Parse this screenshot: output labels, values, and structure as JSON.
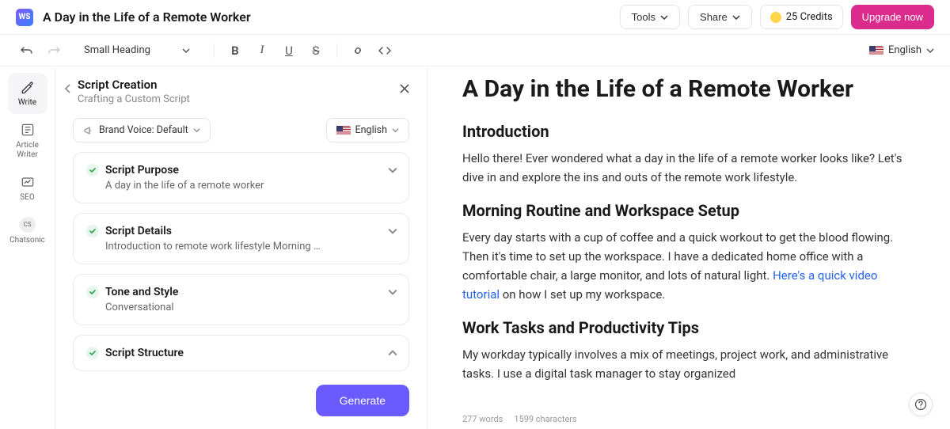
{
  "header": {
    "logo_text": "WS",
    "doc_title": "A Day in the Life of a Remote Worker",
    "tools_label": "Tools",
    "share_label": "Share",
    "credits_text": "25 Credits",
    "upgrade_label": "Upgrade now"
  },
  "toolbar": {
    "heading_label": "Small Heading",
    "lang_label": "English"
  },
  "rail": {
    "write": "Write",
    "article": "Article Writer",
    "seo": "SEO",
    "chatsonic": "Chatsonic"
  },
  "panel": {
    "title": "Script Creation",
    "subtitle": "Crafting a Custom Script",
    "brand_voice": "Brand Voice: Default",
    "lang": "English",
    "cards": [
      {
        "title": "Script Purpose",
        "sub": "A day in the life of a remote worker",
        "open": false
      },
      {
        "title": "Script Details",
        "sub": "Introduction to remote work lifestyle Morning …",
        "open": false
      },
      {
        "title": "Tone and Style",
        "sub": "Conversational",
        "open": false
      },
      {
        "title": "Script Structure",
        "sub": "",
        "open": true
      }
    ],
    "generate": "Generate"
  },
  "doc": {
    "h1": "A Day in the Life of a Remote Worker",
    "intro_h": "Introduction",
    "intro_p": "Hello there! Ever wondered what a day in the life of a remote worker looks like? Let's dive in and explore the ins and outs of the remote work lifestyle.",
    "morning_h": "Morning Routine and Workspace Setup",
    "morning_p1": "Every day starts with a cup of coffee and a quick workout to get the blood flowing. Then it's time to set up the workspace. I have a dedicated home office with a comfortable chair, a large monitor, and lots of natural light. ",
    "morning_link": "Here's a quick video tutorial",
    "morning_p2": " on how I set up my workspace.",
    "work_h": "Work Tasks and Productivity Tips",
    "work_p": "My workday typically involves a mix of meetings, project work, and administrative tasks. I use a digital task manager to stay organized",
    "words": "277 words",
    "chars": "1599 characters"
  }
}
